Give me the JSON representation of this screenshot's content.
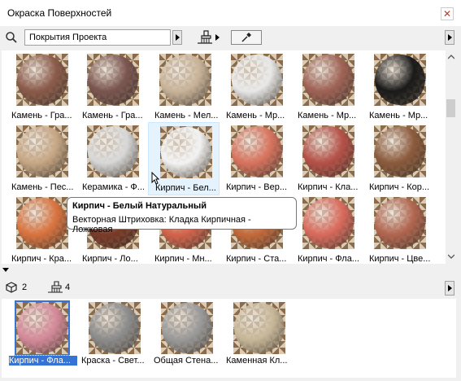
{
  "window": {
    "title": "Окраска Поверхностей",
    "close_icon": "✕"
  },
  "toolbar": {
    "search_value": "Покрытия Проекта",
    "search_icon": "search-icon",
    "brush_icon": "paint-brush-icon",
    "eyedropper_icon": "eyedropper-icon"
  },
  "materials": [
    {
      "label": "Камень - Гра...",
      "color": "#8a5a4a"
    },
    {
      "label": "Камень - Гра...",
      "color": "#7a5550"
    },
    {
      "label": "Камень - Мел...",
      "color": "#c9b49a"
    },
    {
      "label": "Камень - Мр...",
      "color": "#e8e8e8"
    },
    {
      "label": "Камень - Мр...",
      "color": "#9e6255"
    },
    {
      "label": "Камень - Мр...",
      "color": "#1a1a1a"
    },
    {
      "label": "Камень - Пес...",
      "color": "#c7a886"
    },
    {
      "label": "Керамика - Ф...",
      "color": "#d8d8d8"
    },
    {
      "label": "Кирпич - Бел...",
      "color": "#f2f2f2"
    },
    {
      "label": "Кирпич - Вер...",
      "color": "#d8735e"
    },
    {
      "label": "Кирпич - Кла...",
      "color": "#b55047"
    },
    {
      "label": "Кирпич - Кор...",
      "color": "#8b5a3c"
    },
    {
      "label": "Кирпич - Кра...",
      "color": "#d9733f"
    },
    {
      "label": "Кирпич - Ло...",
      "color": "#7a3a28"
    },
    {
      "label": "Кирпич - Мн...",
      "color": "#d4634c"
    },
    {
      "label": "Кирпич - Ста...",
      "color": "#c46a3a"
    },
    {
      "label": "Кирпич - Фла...",
      "color": "#d96a5c"
    },
    {
      "label": "Кирпич - Цве...",
      "color": "#b1654f"
    }
  ],
  "tooltip": {
    "title": "Кирпич - Белый Натуральный",
    "subtitle": "Векторная Штриховка: Кладка Кирпичная - Ложковая"
  },
  "summary": {
    "materials_count": "2",
    "brush_count": "4",
    "cube_icon": "cube-icon",
    "brush_icon": "paint-brush-icon"
  },
  "project_materials": [
    {
      "label": "Кирпич - Фла...",
      "color": "#d48a9a",
      "selected": true
    },
    {
      "label": "Краска - Свет...",
      "color": "#8c8c8c",
      "selected": false
    },
    {
      "label": "Общая Стена...",
      "color": "#9a9a9a",
      "selected": false
    },
    {
      "label": "Каменная Кл...",
      "color": "#c8b89a",
      "selected": false
    }
  ]
}
